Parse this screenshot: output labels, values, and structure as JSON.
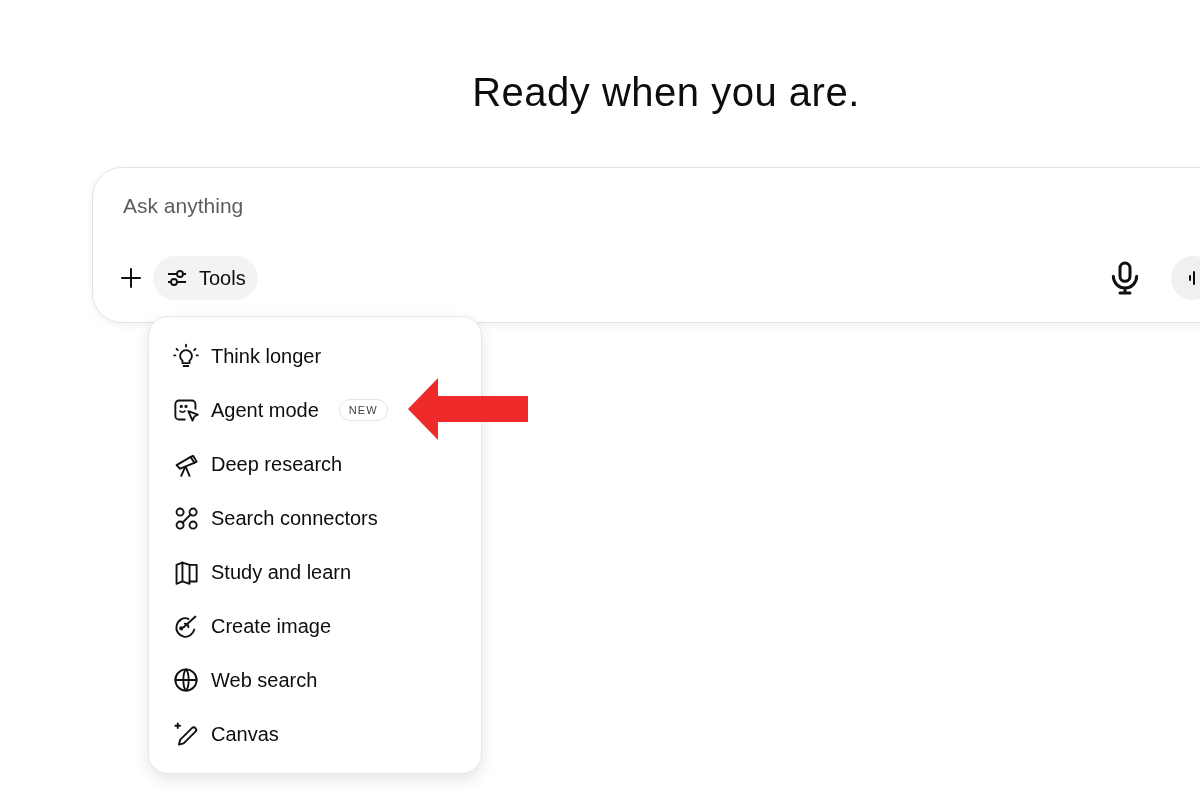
{
  "heading": "Ready when you are.",
  "composer": {
    "placeholder": "Ask anything",
    "tools_label": "Tools"
  },
  "tools_menu": {
    "items": [
      {
        "kind": "bulb",
        "label": "Think longer"
      },
      {
        "kind": "agent",
        "label": "Agent mode",
        "badge": "NEW"
      },
      {
        "kind": "telescope",
        "label": "Deep research"
      },
      {
        "kind": "connectors",
        "label": "Search connectors"
      },
      {
        "kind": "book",
        "label": "Study and learn"
      },
      {
        "kind": "palette",
        "label": "Create image"
      },
      {
        "kind": "globe",
        "label": "Web search"
      },
      {
        "kind": "pen",
        "label": "Canvas"
      }
    ]
  },
  "annotation": {
    "kind": "arrow",
    "color": "#ee2a2a"
  }
}
